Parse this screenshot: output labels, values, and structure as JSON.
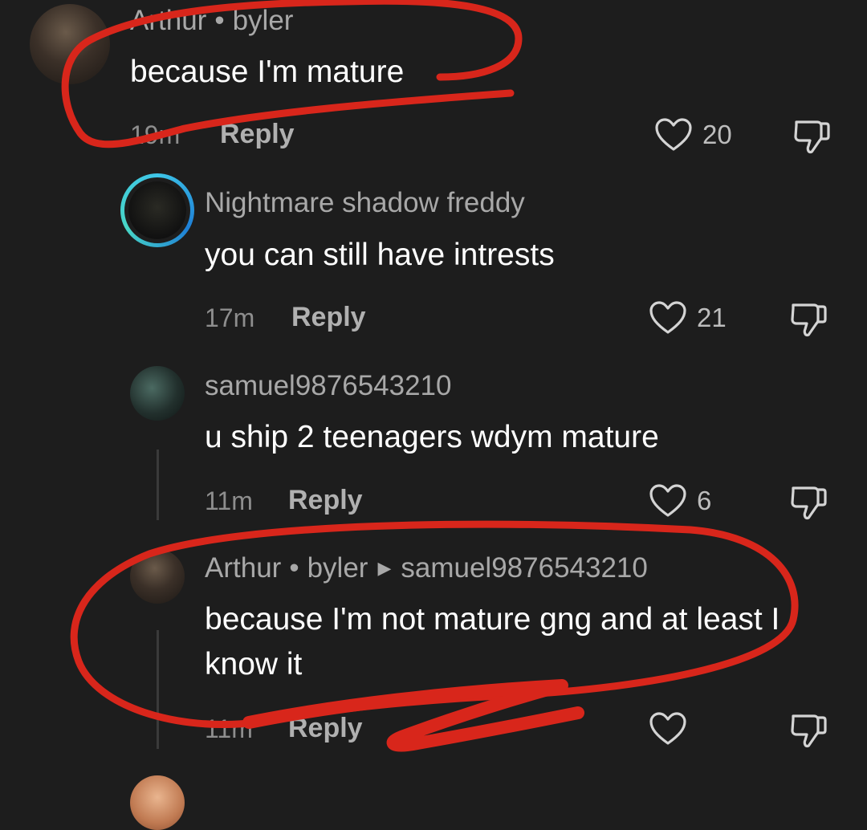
{
  "comments": [
    {
      "username": "Arthur",
      "username_suffix": "byler",
      "text": "because I'm mature",
      "time": "19m",
      "reply_label": "Reply",
      "likes": "20"
    },
    {
      "username": "Nightmare shadow freddy",
      "text": "you can still have intrests",
      "time": "17m",
      "reply_label": "Reply",
      "likes": "21"
    },
    {
      "username": "samuel9876543210",
      "text": "u ship 2 teenagers wdym mature",
      "time": "11m",
      "reply_label": "Reply",
      "likes": "6"
    },
    {
      "username": "Arthur",
      "username_suffix": "byler",
      "reply_to": "samuel9876543210",
      "text": "because I'm not mature gng and at least I know it",
      "time": "11m",
      "reply_label": "Reply",
      "likes": ""
    }
  ],
  "icons": {
    "like": "heart-outline-icon",
    "dislike": "thumbs-down-icon",
    "reply_arrow": "triangle-right-icon"
  },
  "colors": {
    "background": "#1d1d1d",
    "username": "#a8a8a8",
    "text": "#ffffff",
    "annotation": "#d8261b",
    "story_ring": "#3ec6e8"
  }
}
